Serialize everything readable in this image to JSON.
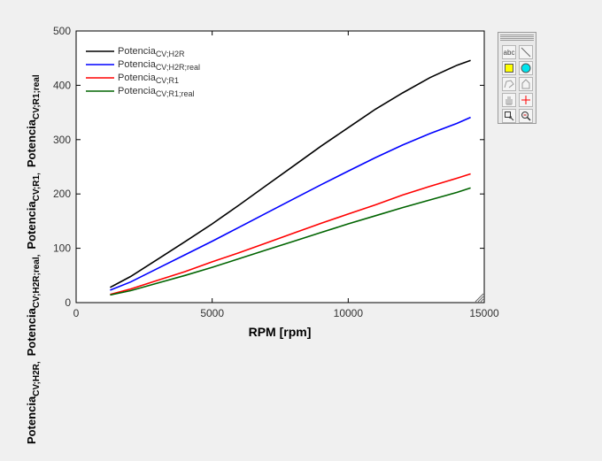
{
  "chart_data": {
    "type": "line",
    "xlabel": "RPM  [rpm]",
    "ylabel_parts": [
      {
        "base": "Potencia",
        "sub": "CV;H2R,"
      },
      {
        "base": "Potencia",
        "sub": "CV;H2R;real,"
      },
      {
        "base": "Potencia",
        "sub": "CV;R1,"
      },
      {
        "base": "Potencia",
        "sub": "CV;R1;real"
      }
    ],
    "xlim": [
      0,
      15000
    ],
    "ylim": [
      0,
      500
    ],
    "xticks": [
      0,
      5000,
      10000,
      15000
    ],
    "yticks": [
      0,
      100,
      200,
      300,
      400,
      500
    ],
    "grid": false,
    "legend_position": "top-left",
    "series": [
      {
        "name": "Potencia",
        "sub": "CV;H2R",
        "color": "#000000",
        "x": [
          1250,
          2000,
          3000,
          4000,
          5000,
          6000,
          7000,
          8000,
          9000,
          10000,
          11000,
          12000,
          13000,
          14000,
          14500
        ],
        "y": [
          28,
          48,
          80,
          112,
          145,
          180,
          216,
          252,
          288,
          322,
          356,
          386,
          414,
          437,
          446
        ]
      },
      {
        "name": "Potencia",
        "sub": "CV;H2R;real",
        "color": "#0000ff",
        "x": [
          1250,
          2000,
          3000,
          4000,
          5000,
          6000,
          7000,
          8000,
          9000,
          10000,
          11000,
          12000,
          13000,
          14000,
          14500
        ],
        "y": [
          23,
          38,
          63,
          88,
          113,
          139,
          165,
          191,
          217,
          242,
          267,
          290,
          311,
          330,
          341
        ]
      },
      {
        "name": "Potencia",
        "sub": "CV;R1",
        "color": "#ff0000",
        "x": [
          1250,
          2000,
          3000,
          4000,
          5000,
          6000,
          7000,
          8000,
          9000,
          10000,
          11000,
          12000,
          13000,
          14000,
          14500
        ],
        "y": [
          15,
          25,
          41,
          57,
          75,
          92,
          110,
          128,
          146,
          163,
          180,
          198,
          214,
          229,
          237
        ]
      },
      {
        "name": "Potencia",
        "sub": "CV;R1;real",
        "color": "#006400",
        "x": [
          1250,
          2000,
          3000,
          4000,
          5000,
          6000,
          7000,
          8000,
          9000,
          10000,
          11000,
          12000,
          13000,
          14000,
          14500
        ],
        "y": [
          14,
          22,
          36,
          50,
          65,
          81,
          97,
          113,
          129,
          145,
          160,
          175,
          189,
          203,
          211
        ]
      }
    ]
  },
  "palette": {
    "tools": [
      "text-tool-icon",
      "line-tool-icon",
      "rectangle-tool-icon",
      "ellipse-tool-icon",
      "freehand-tool-icon",
      "polygon-tool-icon",
      "pan-tool-icon",
      "crosshair-tool-icon",
      "select-tool-icon",
      "zoom-tool-icon"
    ],
    "text_tool_label": "abc",
    "rect_color": "#ffff00",
    "ellipse_color": "#00e5ee",
    "crosshair_color": "#ff0000"
  }
}
